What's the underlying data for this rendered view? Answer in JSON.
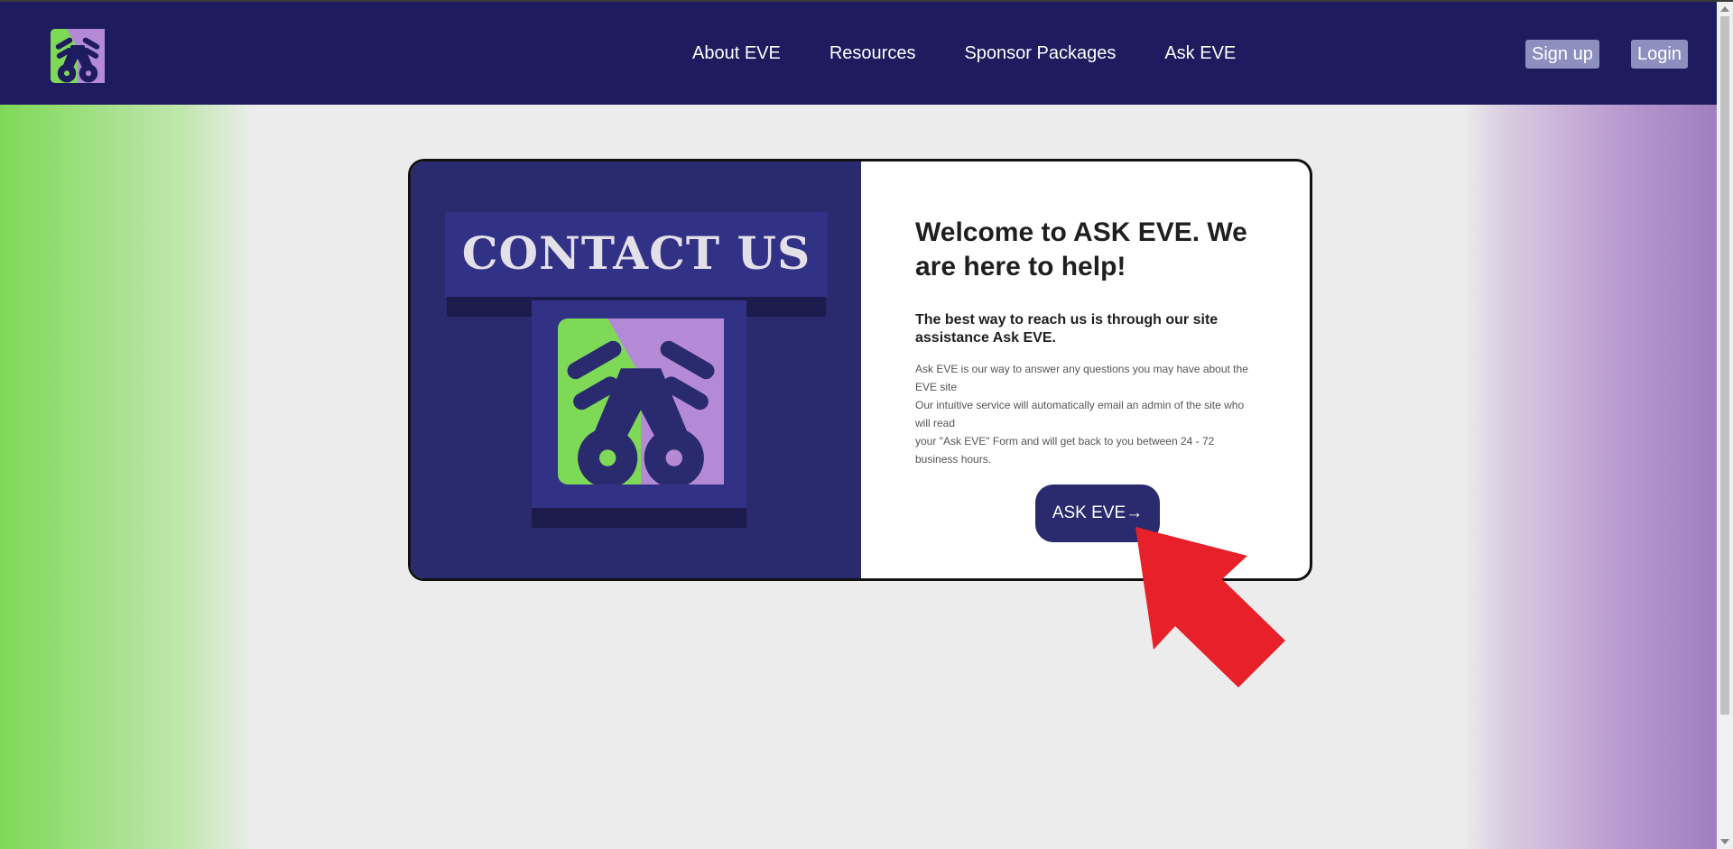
{
  "nav": {
    "logo_icon": "eve-logo-icon",
    "links": [
      "About EVE",
      "Resources",
      "Sponsor Packages",
      "Ask EVE"
    ],
    "signup_label": "Sign up",
    "login_label": "Login"
  },
  "card": {
    "banner_title": "CONTACT US",
    "logo_icon": "eve-logo-icon",
    "heading": "Welcome to ASK EVE. We are here to help!",
    "subheading": "The best way to reach us is through our site assistance Ask EVE.",
    "description_lines": [
      "Ask EVE is our way to answer any questions you may have about the EVE site",
      "Our intuitive service will automatically email an admin of the site who will read",
      "your \"Ask EVE\" Form and will get back to you between 24 - 72 business hours."
    ],
    "button_label": "ASK EVE→"
  },
  "colors": {
    "navbar": "#1e1b5e",
    "card_left": "#2a2a6e",
    "accent_green": "#7ed957",
    "accent_purple": "#b48ad6",
    "arrow_red": "#e8202a"
  },
  "annotation": {
    "icon": "red-pointer-arrow-icon"
  }
}
